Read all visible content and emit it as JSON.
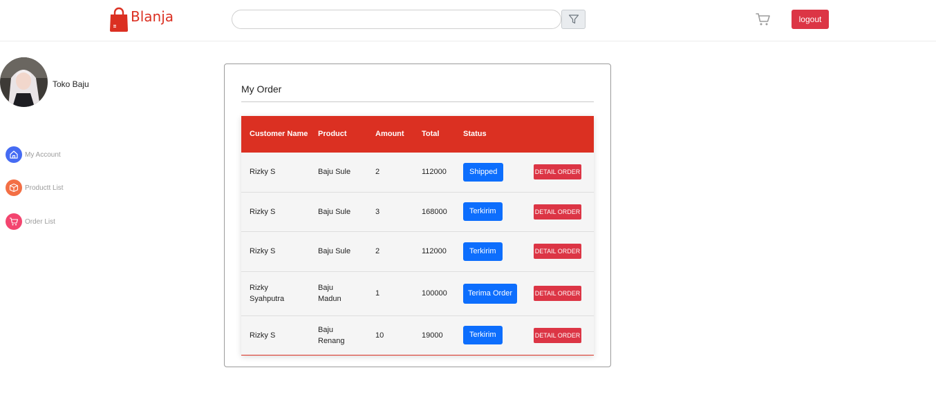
{
  "navbar": {
    "brand": "Blanja",
    "search": {
      "value": "",
      "placeholder": ""
    },
    "filter_icon": "filter-icon",
    "cart_icon": "cart-icon",
    "logout_label": "logout"
  },
  "sidebar": {
    "store_name": "Toko Baju",
    "items": [
      {
        "label": "My Account",
        "icon": "home-icon",
        "color": "#456bf3"
      },
      {
        "label": "Productt List",
        "icon": "box-icon",
        "color": "#f36f45"
      },
      {
        "label": "Order List",
        "icon": "cart-icon",
        "color": "#f3456f"
      }
    ]
  },
  "main": {
    "title": "My Order",
    "table": {
      "headers": [
        "Customer Name",
        "Product",
        "Amount",
        "Total",
        "Status",
        ""
      ],
      "rows": [
        {
          "customer": "Rizky S",
          "product": "Baju Sule",
          "amount": "2",
          "total": "112000",
          "status": "Shipped",
          "action": "DETAIL ORDER"
        },
        {
          "customer": "Rizky S",
          "product": "Baju Sule",
          "amount": "3",
          "total": "168000",
          "status": "Terkirim",
          "action": "DETAIL ORDER"
        },
        {
          "customer": "Rizky S",
          "product": "Baju Sule",
          "amount": "2",
          "total": "112000",
          "status": "Terkirim",
          "action": "DETAIL ORDER"
        },
        {
          "customer": "Rizky Syahputra",
          "product": "Baju Madun",
          "amount": "1",
          "total": "100000",
          "status": "Terima Order",
          "action": "DETAIL ORDER"
        },
        {
          "customer": "Rizky S",
          "product": "Baju Renang",
          "amount": "10",
          "total": "19000",
          "status": "Terkirim",
          "action": "DETAIL ORDER"
        }
      ]
    }
  },
  "colors": {
    "brand": "#db3022",
    "danger": "#dc3545",
    "primary": "#0d6efd"
  }
}
